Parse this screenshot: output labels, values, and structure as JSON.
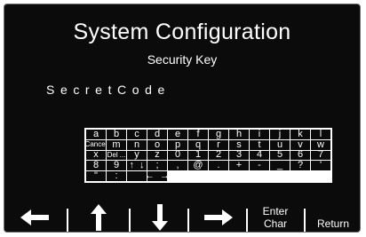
{
  "header": {
    "title": "System Configuration",
    "subtitle": "Security Key"
  },
  "entry": {
    "value": "SecretCode"
  },
  "keyboard": {
    "rows": [
      [
        "a",
        "b",
        "c",
        "d",
        "e",
        "f",
        "g",
        "h",
        "i",
        "j",
        "k",
        "l",
        "Cancel"
      ],
      [
        "m",
        "n",
        "o",
        "p",
        "q",
        "r",
        "s",
        "t",
        "u",
        "v",
        "w",
        "x",
        "Del",
        "..."
      ],
      [
        "y",
        "z",
        "0",
        "1",
        "2",
        "3",
        "4",
        "5",
        "6",
        "7",
        "8",
        "9",
        "↑",
        "↓"
      ],
      [
        ";",
        ",",
        "@",
        ".",
        "+",
        "-",
        "_",
        "?",
        "'",
        "\"",
        ":",
        "",
        "←",
        "→"
      ]
    ]
  },
  "softkeys": {
    "left_icon": "arrow-left-icon",
    "up_icon": "arrow-up-icon",
    "down_icon": "arrow-down-icon",
    "right_icon": "arrow-right-icon",
    "enter_char_line1": "Enter",
    "enter_char_line2": "Char",
    "return_label": "Return"
  }
}
